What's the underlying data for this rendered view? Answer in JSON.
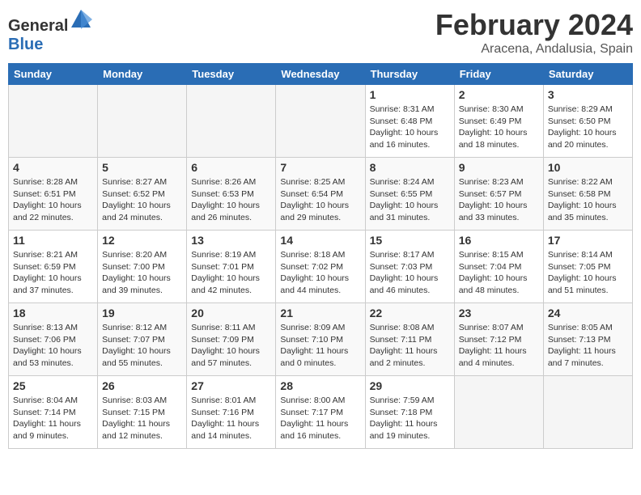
{
  "header": {
    "logo_general": "General",
    "logo_blue": "Blue",
    "month_year": "February 2024",
    "location": "Aracena, Andalusia, Spain"
  },
  "days_of_week": [
    "Sunday",
    "Monday",
    "Tuesday",
    "Wednesday",
    "Thursday",
    "Friday",
    "Saturday"
  ],
  "weeks": [
    [
      {
        "num": "",
        "detail": ""
      },
      {
        "num": "",
        "detail": ""
      },
      {
        "num": "",
        "detail": ""
      },
      {
        "num": "",
        "detail": ""
      },
      {
        "num": "1",
        "detail": "Sunrise: 8:31 AM\nSunset: 6:48 PM\nDaylight: 10 hours\nand 16 minutes."
      },
      {
        "num": "2",
        "detail": "Sunrise: 8:30 AM\nSunset: 6:49 PM\nDaylight: 10 hours\nand 18 minutes."
      },
      {
        "num": "3",
        "detail": "Sunrise: 8:29 AM\nSunset: 6:50 PM\nDaylight: 10 hours\nand 20 minutes."
      }
    ],
    [
      {
        "num": "4",
        "detail": "Sunrise: 8:28 AM\nSunset: 6:51 PM\nDaylight: 10 hours\nand 22 minutes."
      },
      {
        "num": "5",
        "detail": "Sunrise: 8:27 AM\nSunset: 6:52 PM\nDaylight: 10 hours\nand 24 minutes."
      },
      {
        "num": "6",
        "detail": "Sunrise: 8:26 AM\nSunset: 6:53 PM\nDaylight: 10 hours\nand 26 minutes."
      },
      {
        "num": "7",
        "detail": "Sunrise: 8:25 AM\nSunset: 6:54 PM\nDaylight: 10 hours\nand 29 minutes."
      },
      {
        "num": "8",
        "detail": "Sunrise: 8:24 AM\nSunset: 6:55 PM\nDaylight: 10 hours\nand 31 minutes."
      },
      {
        "num": "9",
        "detail": "Sunrise: 8:23 AM\nSunset: 6:57 PM\nDaylight: 10 hours\nand 33 minutes."
      },
      {
        "num": "10",
        "detail": "Sunrise: 8:22 AM\nSunset: 6:58 PM\nDaylight: 10 hours\nand 35 minutes."
      }
    ],
    [
      {
        "num": "11",
        "detail": "Sunrise: 8:21 AM\nSunset: 6:59 PM\nDaylight: 10 hours\nand 37 minutes."
      },
      {
        "num": "12",
        "detail": "Sunrise: 8:20 AM\nSunset: 7:00 PM\nDaylight: 10 hours\nand 39 minutes."
      },
      {
        "num": "13",
        "detail": "Sunrise: 8:19 AM\nSunset: 7:01 PM\nDaylight: 10 hours\nand 42 minutes."
      },
      {
        "num": "14",
        "detail": "Sunrise: 8:18 AM\nSunset: 7:02 PM\nDaylight: 10 hours\nand 44 minutes."
      },
      {
        "num": "15",
        "detail": "Sunrise: 8:17 AM\nSunset: 7:03 PM\nDaylight: 10 hours\nand 46 minutes."
      },
      {
        "num": "16",
        "detail": "Sunrise: 8:15 AM\nSunset: 7:04 PM\nDaylight: 10 hours\nand 48 minutes."
      },
      {
        "num": "17",
        "detail": "Sunrise: 8:14 AM\nSunset: 7:05 PM\nDaylight: 10 hours\nand 51 minutes."
      }
    ],
    [
      {
        "num": "18",
        "detail": "Sunrise: 8:13 AM\nSunset: 7:06 PM\nDaylight: 10 hours\nand 53 minutes."
      },
      {
        "num": "19",
        "detail": "Sunrise: 8:12 AM\nSunset: 7:07 PM\nDaylight: 10 hours\nand 55 minutes."
      },
      {
        "num": "20",
        "detail": "Sunrise: 8:11 AM\nSunset: 7:09 PM\nDaylight: 10 hours\nand 57 minutes."
      },
      {
        "num": "21",
        "detail": "Sunrise: 8:09 AM\nSunset: 7:10 PM\nDaylight: 11 hours\nand 0 minutes."
      },
      {
        "num": "22",
        "detail": "Sunrise: 8:08 AM\nSunset: 7:11 PM\nDaylight: 11 hours\nand 2 minutes."
      },
      {
        "num": "23",
        "detail": "Sunrise: 8:07 AM\nSunset: 7:12 PM\nDaylight: 11 hours\nand 4 minutes."
      },
      {
        "num": "24",
        "detail": "Sunrise: 8:05 AM\nSunset: 7:13 PM\nDaylight: 11 hours\nand 7 minutes."
      }
    ],
    [
      {
        "num": "25",
        "detail": "Sunrise: 8:04 AM\nSunset: 7:14 PM\nDaylight: 11 hours\nand 9 minutes."
      },
      {
        "num": "26",
        "detail": "Sunrise: 8:03 AM\nSunset: 7:15 PM\nDaylight: 11 hours\nand 12 minutes."
      },
      {
        "num": "27",
        "detail": "Sunrise: 8:01 AM\nSunset: 7:16 PM\nDaylight: 11 hours\nand 14 minutes."
      },
      {
        "num": "28",
        "detail": "Sunrise: 8:00 AM\nSunset: 7:17 PM\nDaylight: 11 hours\nand 16 minutes."
      },
      {
        "num": "29",
        "detail": "Sunrise: 7:59 AM\nSunset: 7:18 PM\nDaylight: 11 hours\nand 19 minutes."
      },
      {
        "num": "",
        "detail": ""
      },
      {
        "num": "",
        "detail": ""
      }
    ]
  ]
}
